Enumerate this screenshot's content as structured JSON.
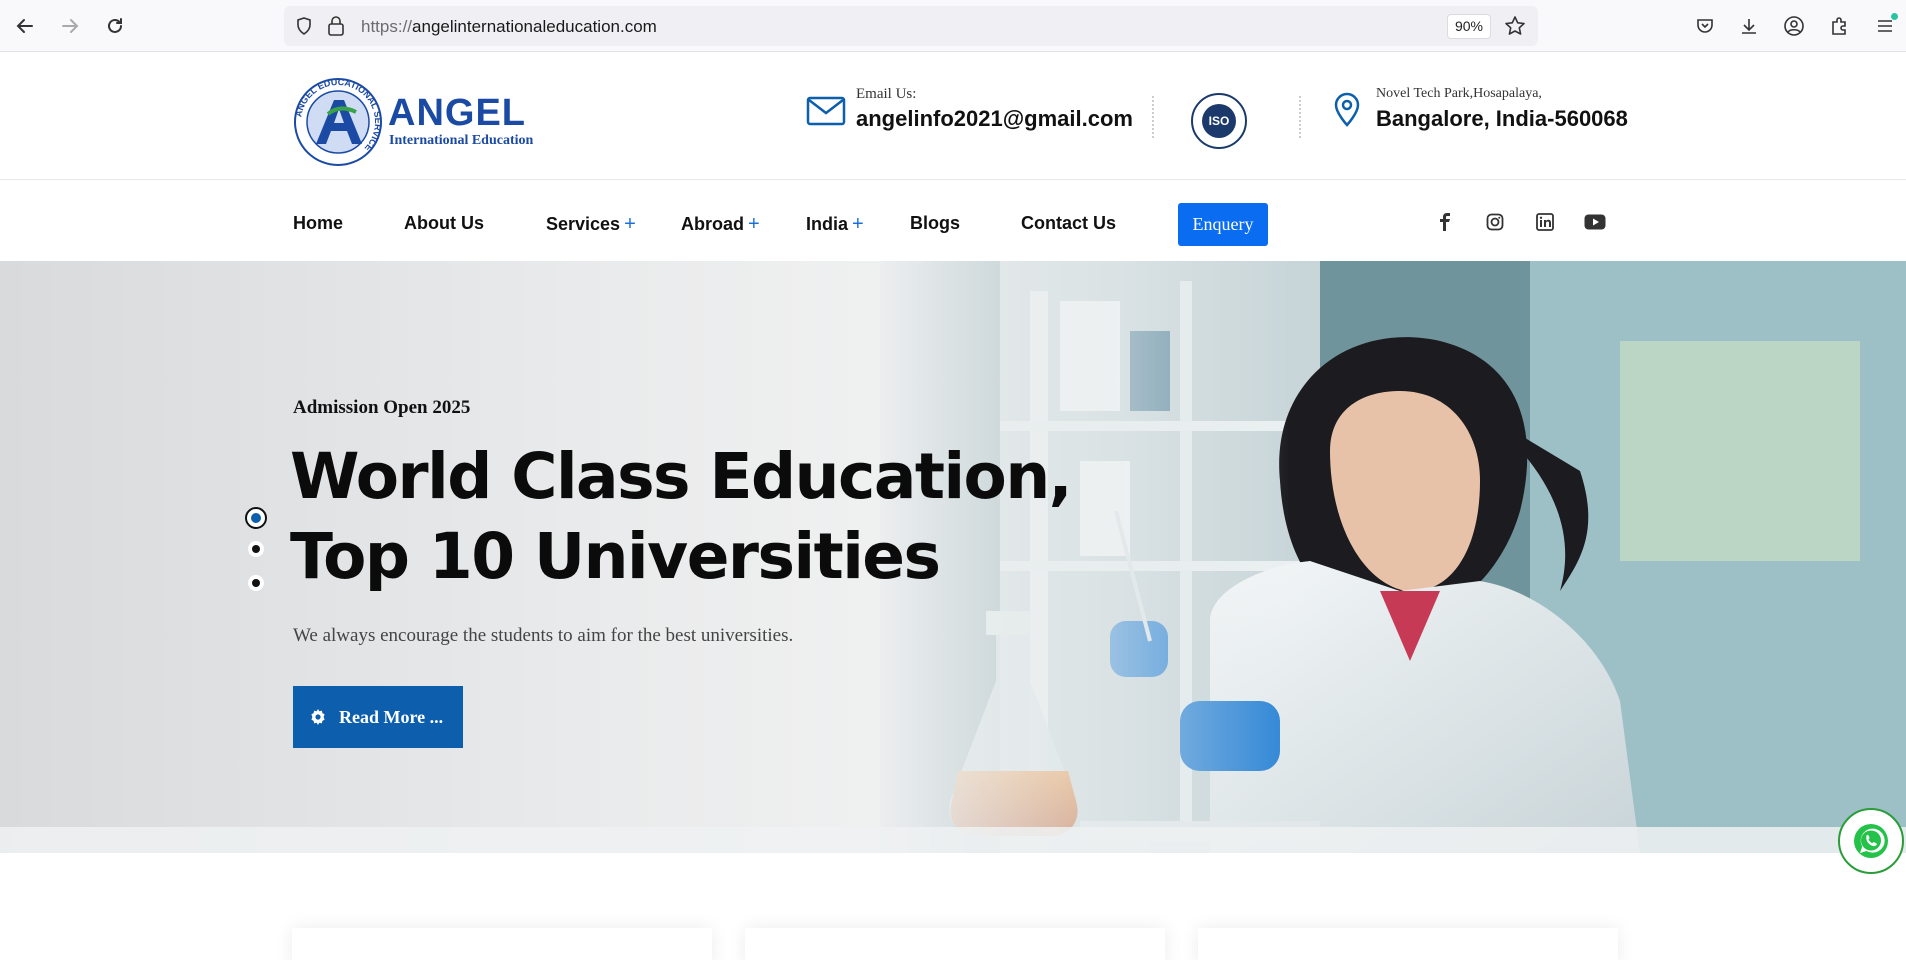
{
  "browser": {
    "url_scheme": "https://",
    "url_host": "angelinternationaleducation.com",
    "zoom": "90%"
  },
  "header": {
    "logo_main": "ANGEL",
    "logo_sub": "International Education",
    "logo_ring_text": "ANGEL EDUCATIONAL SERVICE",
    "email_label": "Email Us:",
    "email_value": "angelinfo2021@gmail.com",
    "iso_badge_text": "ISO",
    "address_line1": "Novel Tech Park,Hosapalaya,",
    "address_line2": "Bangalore, India-560068"
  },
  "nav": {
    "items": [
      {
        "label": "Home",
        "has_plus": false
      },
      {
        "label": "About Us",
        "has_plus": false
      },
      {
        "label": "Services",
        "has_plus": true
      },
      {
        "label": "Abroad",
        "has_plus": true
      },
      {
        "label": "India",
        "has_plus": true
      },
      {
        "label": "Blogs",
        "has_plus": false
      },
      {
        "label": "Contact Us",
        "has_plus": false
      }
    ],
    "plus_symbol": "+",
    "enquery_label": "Enquery",
    "social": [
      "facebook-icon",
      "instagram-icon",
      "linkedin-icon",
      "youtube-icon"
    ]
  },
  "hero": {
    "tag": "Admission Open 2025",
    "title_line1": "World Class Education,",
    "title_line2": "Top 10 Universities",
    "description": "We always encourage the students to aim for the best universities.",
    "button_label": "Read More ...",
    "slide_count": 3,
    "active_slide": 1
  },
  "colors": {
    "primary": "#0d5fad",
    "enquery_bg": "#0a6cf0",
    "nav_plus": "#1d6fd8",
    "logo_blue": "#1b4aa4",
    "whatsapp_green": "#2a9d3a"
  }
}
